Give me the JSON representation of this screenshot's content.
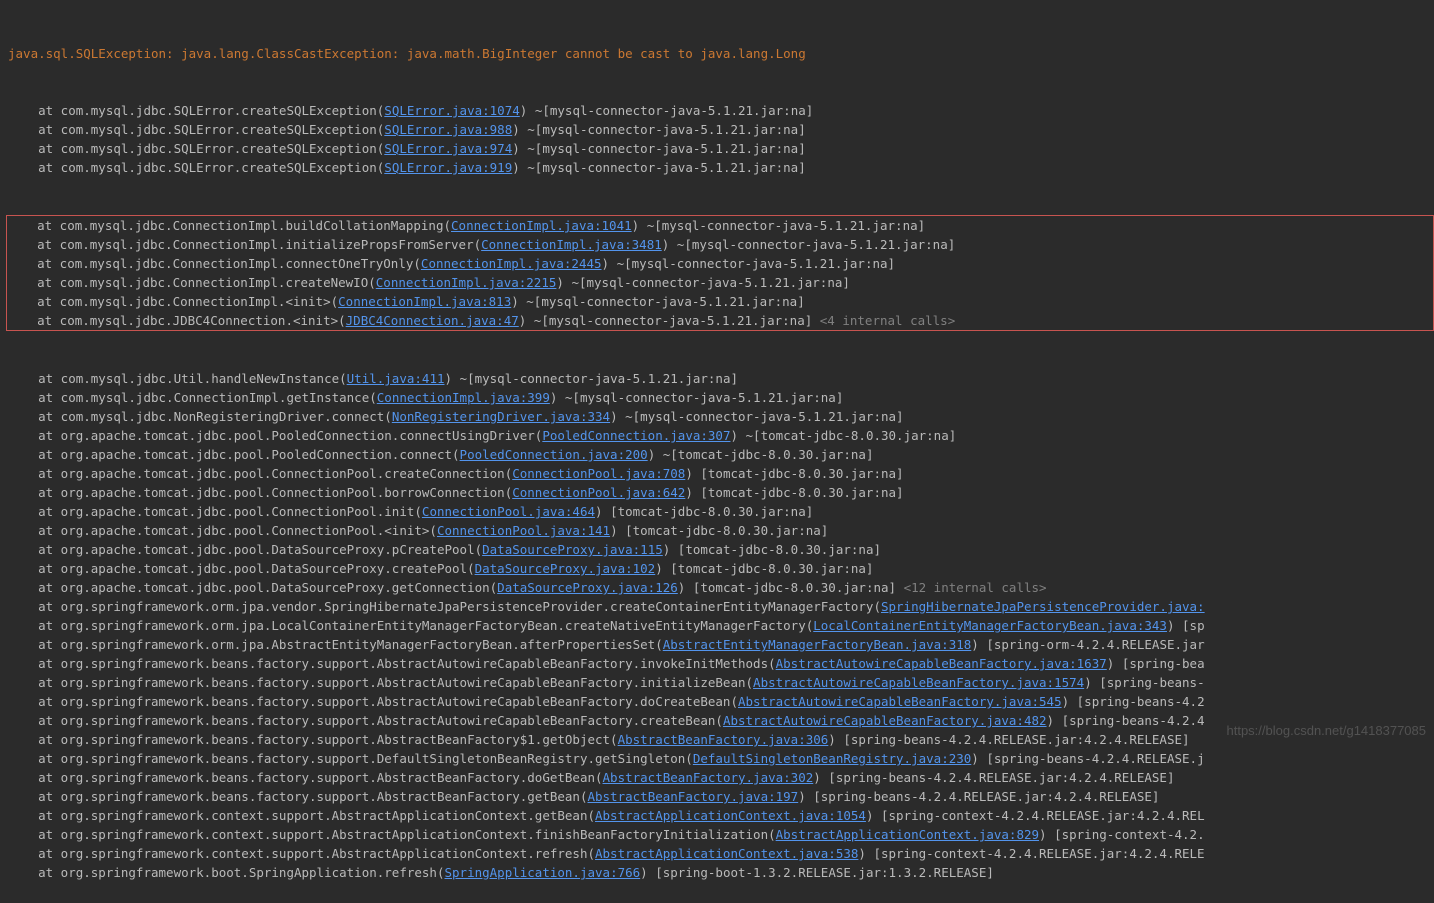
{
  "header": "java.sql.SQLException: java.lang.ClassCastException: java.math.BigInteger cannot be cast to java.lang.Long",
  "pre_box": [
    {
      "prefix": "    at com.mysql.jdbc.SQLError.createSQLException(",
      "link": "SQLError.java:1074",
      "suffix": ") ~[mysql-connector-java-5.1.21.jar:na]"
    },
    {
      "prefix": "    at com.mysql.jdbc.SQLError.createSQLException(",
      "link": "SQLError.java:988",
      "suffix": ") ~[mysql-connector-java-5.1.21.jar:na]"
    },
    {
      "prefix": "    at com.mysql.jdbc.SQLError.createSQLException(",
      "link": "SQLError.java:974",
      "suffix": ") ~[mysql-connector-java-5.1.21.jar:na]"
    },
    {
      "prefix": "    at com.mysql.jdbc.SQLError.createSQLException(",
      "link": "SQLError.java:919",
      "suffix": ") ~[mysql-connector-java-5.1.21.jar:na]"
    }
  ],
  "boxed": [
    {
      "prefix": "    at com.mysql.jdbc.ConnectionImpl.buildCollationMapping(",
      "link": "ConnectionImpl.java:1041",
      "suffix": ") ~[mysql-connector-java-5.1.21.jar:na]"
    },
    {
      "prefix": "    at com.mysql.jdbc.ConnectionImpl.initializePropsFromServer(",
      "link": "ConnectionImpl.java:3481",
      "suffix": ") ~[mysql-connector-java-5.1.21.jar:na]"
    },
    {
      "prefix": "    at com.mysql.jdbc.ConnectionImpl.connectOneTryOnly(",
      "link": "ConnectionImpl.java:2445",
      "suffix": ") ~[mysql-connector-java-5.1.21.jar:na]"
    },
    {
      "prefix": "    at com.mysql.jdbc.ConnectionImpl.createNewIO(",
      "link": "ConnectionImpl.java:2215",
      "suffix": ") ~[mysql-connector-java-5.1.21.jar:na]"
    },
    {
      "prefix": "    at com.mysql.jdbc.ConnectionImpl.<init>(",
      "link": "ConnectionImpl.java:813",
      "suffix": ") ~[mysql-connector-java-5.1.21.jar:na]"
    },
    {
      "prefix": "    at com.mysql.jdbc.JDBC4Connection.<init>(",
      "link": "JDBC4Connection.java:47",
      "suffix": ") ~[mysql-connector-java-5.1.21.jar:na]",
      "trail": " <4 internal calls>"
    }
  ],
  "post_box": [
    {
      "prefix": "    at com.mysql.jdbc.Util.handleNewInstance(",
      "link": "Util.java:411",
      "suffix": ") ~[mysql-connector-java-5.1.21.jar:na]"
    },
    {
      "prefix": "    at com.mysql.jdbc.ConnectionImpl.getInstance(",
      "link": "ConnectionImpl.java:399",
      "suffix": ") ~[mysql-connector-java-5.1.21.jar:na]"
    },
    {
      "prefix": "    at com.mysql.jdbc.NonRegisteringDriver.connect(",
      "link": "NonRegisteringDriver.java:334",
      "suffix": ") ~[mysql-connector-java-5.1.21.jar:na]"
    },
    {
      "prefix": "    at org.apache.tomcat.jdbc.pool.PooledConnection.connectUsingDriver(",
      "link": "PooledConnection.java:307",
      "suffix": ") ~[tomcat-jdbc-8.0.30.jar:na]"
    },
    {
      "prefix": "    at org.apache.tomcat.jdbc.pool.PooledConnection.connect(",
      "link": "PooledConnection.java:200",
      "suffix": ") ~[tomcat-jdbc-8.0.30.jar:na]"
    },
    {
      "prefix": "    at org.apache.tomcat.jdbc.pool.ConnectionPool.createConnection(",
      "link": "ConnectionPool.java:708",
      "suffix": ") [tomcat-jdbc-8.0.30.jar:na]"
    },
    {
      "prefix": "    at org.apache.tomcat.jdbc.pool.ConnectionPool.borrowConnection(",
      "link": "ConnectionPool.java:642",
      "suffix": ") [tomcat-jdbc-8.0.30.jar:na]"
    },
    {
      "prefix": "    at org.apache.tomcat.jdbc.pool.ConnectionPool.init(",
      "link": "ConnectionPool.java:464",
      "suffix": ") [tomcat-jdbc-8.0.30.jar:na]"
    },
    {
      "prefix": "    at org.apache.tomcat.jdbc.pool.ConnectionPool.<init>(",
      "link": "ConnectionPool.java:141",
      "suffix": ") [tomcat-jdbc-8.0.30.jar:na]"
    },
    {
      "prefix": "    at org.apache.tomcat.jdbc.pool.DataSourceProxy.pCreatePool(",
      "link": "DataSourceProxy.java:115",
      "suffix": ") [tomcat-jdbc-8.0.30.jar:na]"
    },
    {
      "prefix": "    at org.apache.tomcat.jdbc.pool.DataSourceProxy.createPool(",
      "link": "DataSourceProxy.java:102",
      "suffix": ") [tomcat-jdbc-8.0.30.jar:na]"
    },
    {
      "prefix": "    at org.apache.tomcat.jdbc.pool.DataSourceProxy.getConnection(",
      "link": "DataSourceProxy.java:126",
      "suffix": ") [tomcat-jdbc-8.0.30.jar:na]",
      "trail": " <12 internal calls>"
    },
    {
      "prefix": "    at org.springframework.orm.jpa.vendor.SpringHibernateJpaPersistenceProvider.createContainerEntityManagerFactory(",
      "link": "SpringHibernateJpaPersistenceProvider.java:",
      "suffix": ""
    },
    {
      "prefix": "    at org.springframework.orm.jpa.LocalContainerEntityManagerFactoryBean.createNativeEntityManagerFactory(",
      "link": "LocalContainerEntityManagerFactoryBean.java:343",
      "suffix": ") [sp"
    },
    {
      "prefix": "    at org.springframework.orm.jpa.AbstractEntityManagerFactoryBean.afterPropertiesSet(",
      "link": "AbstractEntityManagerFactoryBean.java:318",
      "suffix": ") [spring-orm-4.2.4.RELEASE.jar"
    },
    {
      "prefix": "    at org.springframework.beans.factory.support.AbstractAutowireCapableBeanFactory.invokeInitMethods(",
      "link": "AbstractAutowireCapableBeanFactory.java:1637",
      "suffix": ") [spring-bea"
    },
    {
      "prefix": "    at org.springframework.beans.factory.support.AbstractAutowireCapableBeanFactory.initializeBean(",
      "link": "AbstractAutowireCapableBeanFactory.java:1574",
      "suffix": ") [spring-beans-"
    },
    {
      "prefix": "    at org.springframework.beans.factory.support.AbstractAutowireCapableBeanFactory.doCreateBean(",
      "link": "AbstractAutowireCapableBeanFactory.java:545",
      "suffix": ") [spring-beans-4.2"
    },
    {
      "prefix": "    at org.springframework.beans.factory.support.AbstractAutowireCapableBeanFactory.createBean(",
      "link": "AbstractAutowireCapableBeanFactory.java:482",
      "suffix": ") [spring-beans-4.2.4"
    },
    {
      "prefix": "    at org.springframework.beans.factory.support.AbstractBeanFactory$1.getObject(",
      "link": "AbstractBeanFactory.java:306",
      "suffix": ") [spring-beans-4.2.4.RELEASE.jar:4.2.4.RELEASE]"
    },
    {
      "prefix": "    at org.springframework.beans.factory.support.DefaultSingletonBeanRegistry.getSingleton(",
      "link": "DefaultSingletonBeanRegistry.java:230",
      "suffix": ") [spring-beans-4.2.4.RELEASE.j"
    },
    {
      "prefix": "    at org.springframework.beans.factory.support.AbstractBeanFactory.doGetBean(",
      "link": "AbstractBeanFactory.java:302",
      "suffix": ") [spring-beans-4.2.4.RELEASE.jar:4.2.4.RELEASE]"
    },
    {
      "prefix": "    at org.springframework.beans.factory.support.AbstractBeanFactory.getBean(",
      "link": "AbstractBeanFactory.java:197",
      "suffix": ") [spring-beans-4.2.4.RELEASE.jar:4.2.4.RELEASE]"
    },
    {
      "prefix": "    at org.springframework.context.support.AbstractApplicationContext.getBean(",
      "link": "AbstractApplicationContext.java:1054",
      "suffix": ") [spring-context-4.2.4.RELEASE.jar:4.2.4.REL"
    },
    {
      "prefix": "    at org.springframework.context.support.AbstractApplicationContext.finishBeanFactoryInitialization(",
      "link": "AbstractApplicationContext.java:829",
      "suffix": ") [spring-context-4.2."
    },
    {
      "prefix": "    at org.springframework.context.support.AbstractApplicationContext.refresh(",
      "link": "AbstractApplicationContext.java:538",
      "suffix": ") [spring-context-4.2.4.RELEASE.jar:4.2.4.RELE"
    },
    {
      "prefix": "    at org.springframework.boot.SpringApplication.refresh(",
      "link": "SpringApplication.java:766",
      "suffix": ") [spring-boot-1.3.2.RELEASE.jar:1.3.2.RELEASE]"
    }
  ],
  "watermark": "https://blog.csdn.net/g1418377085"
}
